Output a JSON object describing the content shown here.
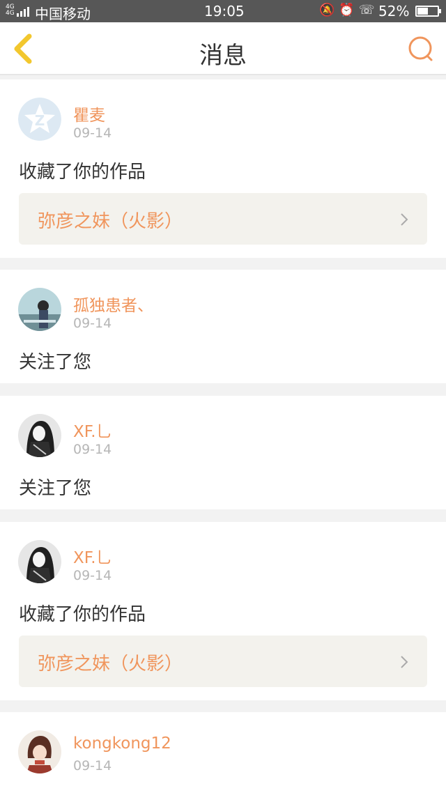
{
  "status_bar": {
    "signal": "4G 4G",
    "carrier": "中国移动",
    "time": "19:05",
    "icons": [
      "bell-muted-icon",
      "alarm-icon",
      "hd-call-icon"
    ],
    "battery_percent_text": "52%",
    "battery_level": 0.52
  },
  "header": {
    "title": "消息"
  },
  "messages": [
    {
      "username": "瞿麦",
      "date": "09-14",
      "action": "收藏了你的作品",
      "work_title": "弥彦之妹（火影）"
    },
    {
      "username": "孤独患者、",
      "date": "09-14",
      "action": "关注了您"
    },
    {
      "username": "XF.乚",
      "date": "09-14",
      "action": "关注了您"
    },
    {
      "username": "XF.乚",
      "date": "09-14",
      "action": "收藏了你的作品",
      "work_title": "弥彦之妹（火影）"
    },
    {
      "username": "kongkong12",
      "date": "09-14"
    }
  ],
  "colors": {
    "accent": "#f0955c",
    "back_icon": "#f2c72e",
    "status_bar_bg": "#575757"
  }
}
